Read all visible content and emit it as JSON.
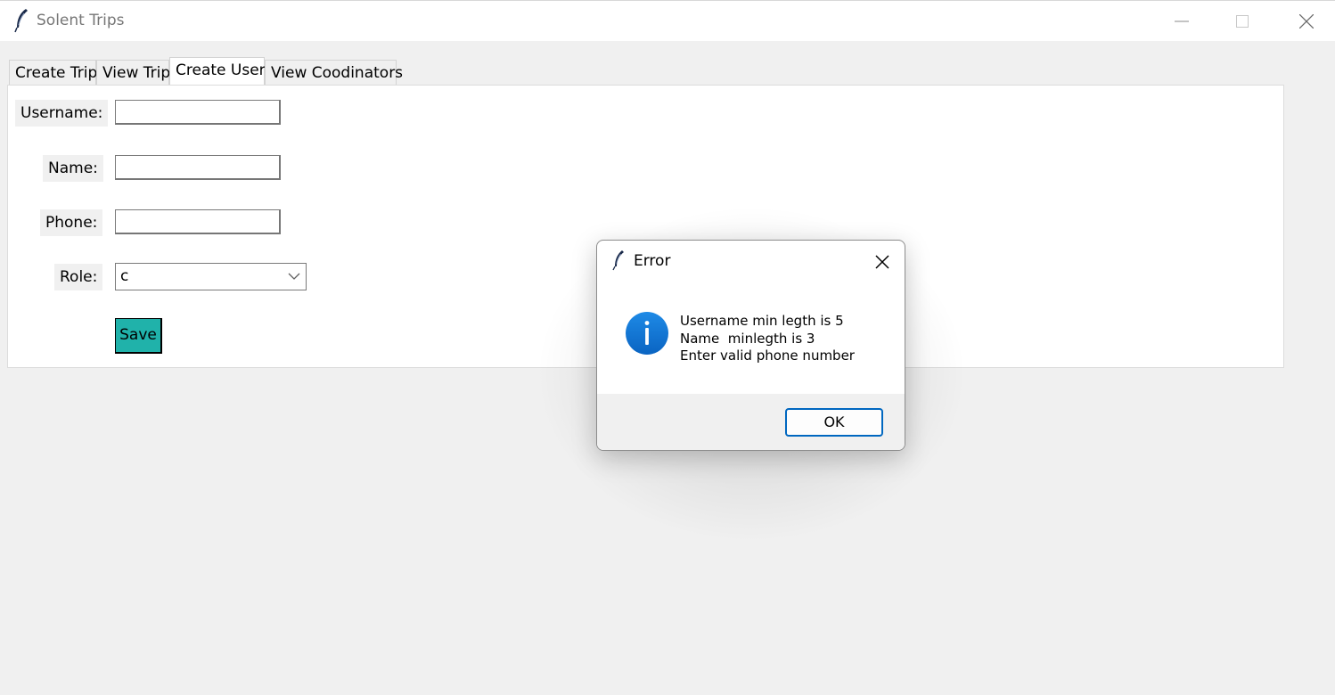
{
  "window": {
    "title": "Solent Trips",
    "icon": "feather-icon"
  },
  "tabs": [
    {
      "label": "Create Trip",
      "active": false
    },
    {
      "label": "View Trip",
      "active": false
    },
    {
      "label": "Create User",
      "active": true
    },
    {
      "label": "View Coodinators",
      "active": false
    }
  ],
  "form": {
    "username_label": "Username:",
    "username_value": "",
    "name_label": "Name:",
    "name_value": "",
    "phone_label": "Phone:",
    "phone_value": "",
    "role_label": "Role:",
    "role_value": "c",
    "save_label": "Save"
  },
  "dialog": {
    "title": "Error",
    "icon": "info-icon",
    "messages": [
      "Username min legth is 5",
      "Name  minlegth is 3",
      "Enter valid phone number"
    ],
    "ok_label": "OK"
  },
  "colors": {
    "save_button": "#20b2aa",
    "info_icon": "#0a74d1",
    "ok_border": "#0067c0"
  }
}
